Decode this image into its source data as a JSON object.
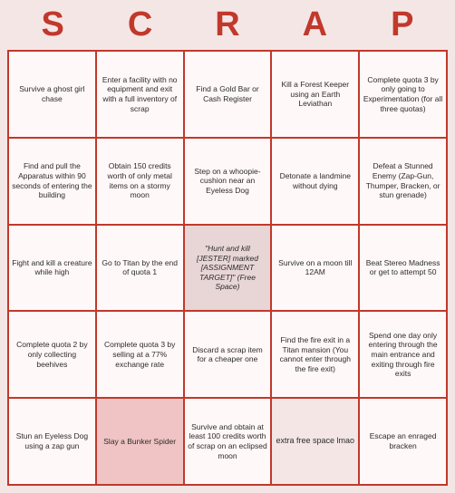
{
  "header": {
    "letters": [
      "S",
      "C",
      "R",
      "A",
      "P"
    ]
  },
  "cells": [
    {
      "text": "Survive a ghost girl chase",
      "highlighted": false
    },
    {
      "text": "Enter a facility with no equipment and exit with a full inventory of scrap",
      "highlighted": false
    },
    {
      "text": "Find a Gold Bar or Cash Register",
      "highlighted": false
    },
    {
      "text": "Kill a Forest Keeper using an Earth Leviathan",
      "highlighted": false
    },
    {
      "text": "Complete quota 3 by only going to Experimentation (for all three quotas)",
      "highlighted": false
    },
    {
      "text": "Find and pull the Apparatus within 90 seconds of entering the building",
      "highlighted": false
    },
    {
      "text": "Obtain 150 credits worth of only metal items on a stormy moon",
      "highlighted": false
    },
    {
      "text": "Step on a whoopie-cushion near an Eyeless Dog",
      "highlighted": false
    },
    {
      "text": "Detonate a landmine without dying",
      "highlighted": false
    },
    {
      "text": "Defeat a Stunned Enemy (Zap-Gun, Thumper, Bracken, or stun grenade)",
      "highlighted": false
    },
    {
      "text": "Fight and kill a creature while high",
      "highlighted": false
    },
    {
      "text": "Go to Titan by the end of quota 1",
      "highlighted": false
    },
    {
      "text": "\"Hunt and kill [JESTER] marked [ASSIGNMENT TARGET]\" (Free Space)",
      "highlighted": true,
      "free": true
    },
    {
      "text": "Survive on a moon till 12AM",
      "highlighted": false
    },
    {
      "text": "Beat Stereo Madness or get to attempt 50",
      "highlighted": false
    },
    {
      "text": "Complete quota 2 by only collecting beehives",
      "highlighted": false
    },
    {
      "text": "Complete quota 3 by selling at a 77% exchange rate",
      "highlighted": false
    },
    {
      "text": "Discard a scrap item for a cheaper one",
      "highlighted": false
    },
    {
      "text": "Find the fire exit in a Titan mansion (You cannot enter through the fire exit)",
      "highlighted": false
    },
    {
      "text": "Spend one day only entering through the main entrance and exiting through fire exits",
      "highlighted": false
    },
    {
      "text": "Stun an Eyeless Dog using a zap gun",
      "highlighted": false
    },
    {
      "text": "Slay a Bunker Spider",
      "highlighted": true
    },
    {
      "text": "Survive and obtain at least 100 credits worth of scrap on an eclipsed moon",
      "highlighted": false
    },
    {
      "text": "extra free space lmao",
      "highlighted": false,
      "extra": true
    },
    {
      "text": "Escape an enraged bracken",
      "highlighted": false
    }
  ]
}
